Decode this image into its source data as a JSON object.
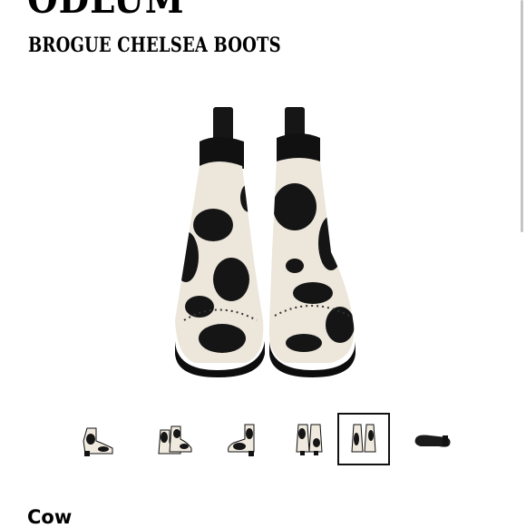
{
  "product": {
    "brand": "ODLUM",
    "title": "BROGUE CHELSEA BOOTS",
    "color_label": "Cow"
  },
  "main_image": {
    "alt": "Brogue Chelsea Boots cow print front view"
  },
  "thumbnails": [
    {
      "name": "thumb-side-view",
      "selected": false
    },
    {
      "name": "thumb-pair-angle",
      "selected": false
    },
    {
      "name": "thumb-side-profile",
      "selected": false
    },
    {
      "name": "thumb-back-pair",
      "selected": false
    },
    {
      "name": "thumb-front-pair",
      "selected": true
    },
    {
      "name": "thumb-sole-view",
      "selected": false
    }
  ],
  "colors": {
    "text": "#000000",
    "selected_border": "#111111",
    "scrollbar": "#c4c4c4"
  }
}
